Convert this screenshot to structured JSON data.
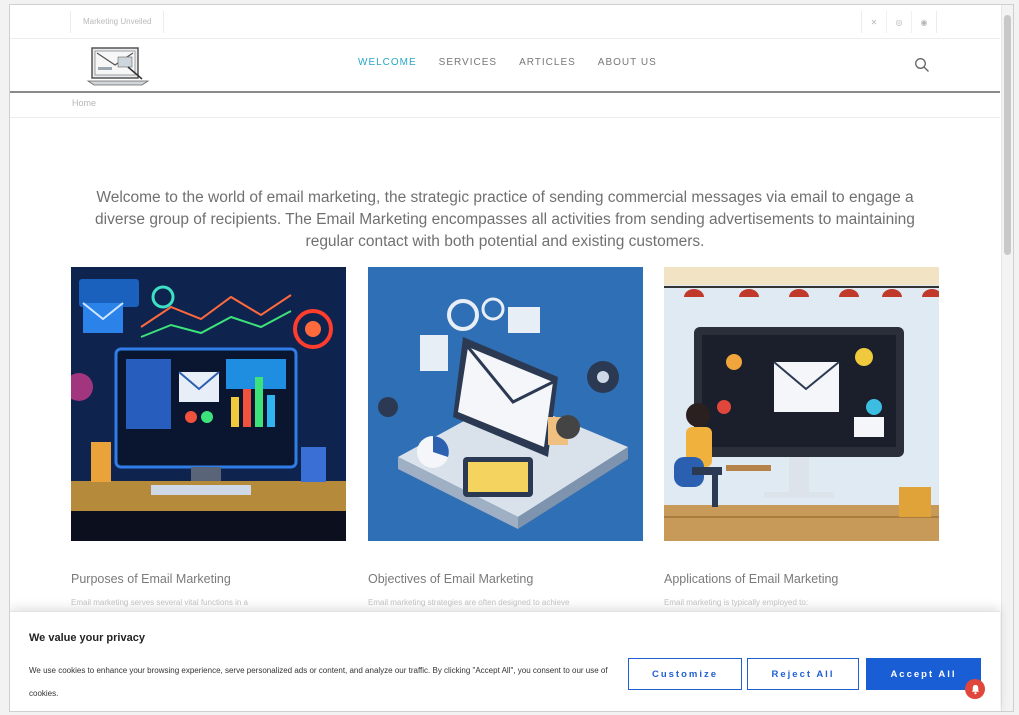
{
  "topbar": {
    "site_name": "Marketing Unveiled",
    "social_icons": [
      "x-icon",
      "instagram-icon",
      "pinterest-icon"
    ]
  },
  "nav": {
    "items": [
      {
        "label": "WELCOME",
        "active": true
      },
      {
        "label": "SERVICES",
        "active": false
      },
      {
        "label": "ARTICLES",
        "active": false
      },
      {
        "label": "ABOUT US",
        "active": false
      }
    ]
  },
  "breadcrumb": {
    "home": "Home"
  },
  "intro": {
    "text": "Welcome to the world of email marketing, the strategic practice of sending commercial messages via email to engage a diverse group of recipients. The Email Marketing encompasses all activities from sending advertisements to maintaining regular contact with both potential and existing customers."
  },
  "cards": [
    {
      "title": "Purposes of Email Marketing",
      "excerpt": "Email marketing serves several vital functions in a"
    },
    {
      "title": "Objectives of Email Marketing",
      "excerpt": "Email marketing strategies are often designed to achieve"
    },
    {
      "title": "Applications of Email Marketing",
      "excerpt": "Email marketing is typically employed to:"
    }
  ],
  "cookie": {
    "title": "We value your privacy",
    "text": "We use cookies to enhance your browsing experience, serve personalized ads or content, and analyze our traffic. By clicking \"Accept All\", you consent to our use of cookies.",
    "customize": "Customize",
    "reject": "Reject All",
    "accept": "Accept All"
  },
  "colors": {
    "accent": "#2aa6c6",
    "button_blue": "#1a5ed6",
    "notification": "#e0463b"
  }
}
